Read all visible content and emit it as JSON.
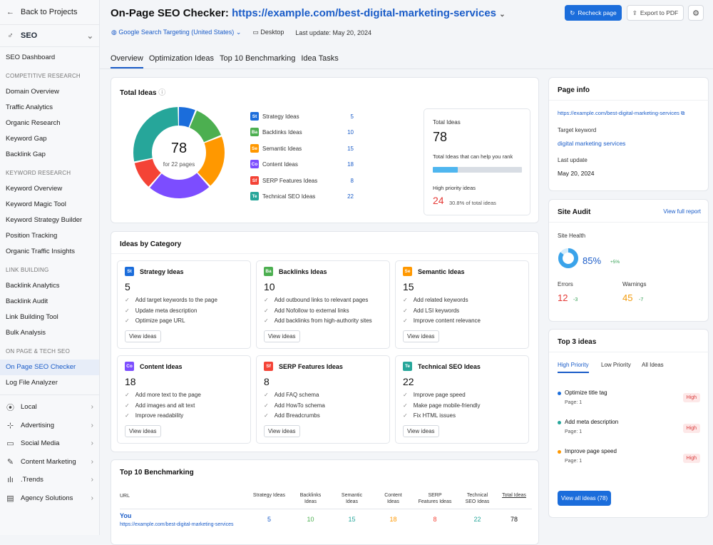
{
  "sidebar": {
    "back": "Back to Projects",
    "section": "SEO",
    "dashboard": "SEO Dashboard",
    "groups": [
      {
        "heading": "COMPETITIVE RESEARCH",
        "items": [
          "Domain Overview",
          "Traffic Analytics",
          "Organic Research",
          "Keyword Gap",
          "Backlink Gap"
        ]
      },
      {
        "heading": "KEYWORD RESEARCH",
        "items": [
          "Keyword Overview",
          "Keyword Magic Tool",
          "Keyword Strategy Builder",
          "Position Tracking",
          "Organic Traffic Insights"
        ]
      },
      {
        "heading": "LINK BUILDING",
        "items": [
          "Backlink Analytics",
          "Backlink Audit",
          "Link Building Tool",
          "Bulk Analysis"
        ]
      },
      {
        "heading": "ON PAGE & TECH SEO",
        "items": [
          "On Page SEO Checker",
          "Log File Analyzer"
        ]
      }
    ],
    "categories": [
      "Local",
      "Advertising",
      "Social Media",
      "Content Marketing",
      ".Trends",
      "Agency Solutions"
    ]
  },
  "header": {
    "title_prefix": "On-Page SEO Checker:",
    "title_url": "https://example.com/best-digital-marketing-services",
    "targeting": "Google Search Targeting (United States)",
    "device": "Desktop",
    "last_update": "Last update: May 20, 2024",
    "recheck": "Recheck page",
    "export": "Export to PDF"
  },
  "tabs": [
    "Overview",
    "Optimization Ideas",
    "Top 10 Benchmarking",
    "Idea Tasks"
  ],
  "total_ideas": {
    "title": "Total Ideas",
    "center_value": "78",
    "center_label": "for 22 pages",
    "legend": [
      {
        "abbr": "St",
        "label": "Strategy Ideas",
        "value": "5",
        "color": "#1b6ddb"
      },
      {
        "abbr": "Ba",
        "label": "Backlinks Ideas",
        "value": "10",
        "color": "#4caf50"
      },
      {
        "abbr": "Se",
        "label": "Semantic Ideas",
        "value": "15",
        "color": "#ff9800"
      },
      {
        "abbr": "Co",
        "label": "Content Ideas",
        "value": "18",
        "color": "#7c4dff"
      },
      {
        "abbr": "Sf",
        "label": "SERP Features Ideas",
        "value": "8",
        "color": "#f44336"
      },
      {
        "abbr": "Te",
        "label": "Technical SEO Ideas",
        "value": "22",
        "color": "#26a69a"
      }
    ],
    "summary_title": "Total Ideas",
    "summary_value": "78",
    "summary_rank": "Total Ideas that can help you rank",
    "rank_fraction": 0.28,
    "priority_title": "High priority ideas",
    "priority_value": "24",
    "priority_pct": "30.8% of total ideas"
  },
  "categories": {
    "title": "Ideas by Category",
    "view": "View ideas",
    "cards": [
      {
        "abbr": "St",
        "color": "#1b6ddb",
        "name": "Strategy Ideas",
        "count": "5",
        "items": [
          "Add target keywords to the page",
          "Update meta description",
          "Optimize page URL"
        ]
      },
      {
        "abbr": "Ba",
        "color": "#4caf50",
        "name": "Backlinks Ideas",
        "count": "10",
        "items": [
          "Add outbound links to relevant pages",
          "Add Nofollow to external links",
          "Add backlinks from high-authority sites"
        ]
      },
      {
        "abbr": "Se",
        "color": "#ff9800",
        "name": "Semantic Ideas",
        "count": "15",
        "items": [
          "Add related keywords",
          "Add LSI keywords",
          "Improve content relevance"
        ]
      },
      {
        "abbr": "Co",
        "color": "#7c4dff",
        "name": "Content Ideas",
        "count": "18",
        "items": [
          "Add more text to the page",
          "Add images and alt text",
          "Improve readability"
        ]
      },
      {
        "abbr": "Sf",
        "color": "#f44336",
        "name": "SERP Features Ideas",
        "count": "8",
        "items": [
          "Add FAQ schema",
          "Add HowTo schema",
          "Add Breadcrumbs"
        ]
      },
      {
        "abbr": "Te",
        "color": "#26a69a",
        "name": "Technical SEO Ideas",
        "count": "22",
        "items": [
          "Improve page speed",
          "Make page mobile-friendly",
          "Fix HTML issues"
        ]
      }
    ]
  },
  "benchmark": {
    "title": "Top 10 Benchmarking",
    "url_header": "URL",
    "headers": [
      "Strategy Ideas",
      "Backlinks Ideas",
      "Semantic Ideas",
      "Content Ideas",
      "SERP Features Ideas",
      "Technical SEO Ideas",
      "Total Ideas"
    ],
    "row_label": "You",
    "row_url": "https://example.com/best-digital-marketing-services",
    "row_values": [
      "5",
      "10",
      "15",
      "18",
      "8",
      "22",
      "78"
    ]
  },
  "page_info": {
    "title": "Page info",
    "url": "https://example.com/best-digital-marketing-services",
    "kw_label": "Target keyword",
    "kw_value": "digital marketing services",
    "update_label": "Last update",
    "update_value": "May 20, 2024"
  },
  "site_audit": {
    "title": "Site Audit",
    "link": "View full report",
    "health_label": "Site Health",
    "health_value": "85%",
    "health_fraction": 0.85,
    "health_delta": "+5%",
    "errors_label": "Errors",
    "errors_value": "12",
    "errors_delta": "-3",
    "warnings_label": "Warnings",
    "warnings_value": "45",
    "warnings_delta": "-7"
  },
  "top3": {
    "title": "Top 3 ideas",
    "tabs": [
      "High Priority",
      "Low Priority",
      "All Ideas"
    ],
    "items": [
      {
        "name": "Optimize title tag",
        "page": "Page: 1",
        "badge": "High",
        "color": "#1b6ddb"
      },
      {
        "name": "Add meta description",
        "page": "Page: 1",
        "badge": "High",
        "color": "#26a69a"
      },
      {
        "name": "Improve page speed",
        "page": "Page: 1",
        "badge": "High",
        "color": "#ff9800"
      }
    ],
    "button": "View all ideas (78)"
  }
}
